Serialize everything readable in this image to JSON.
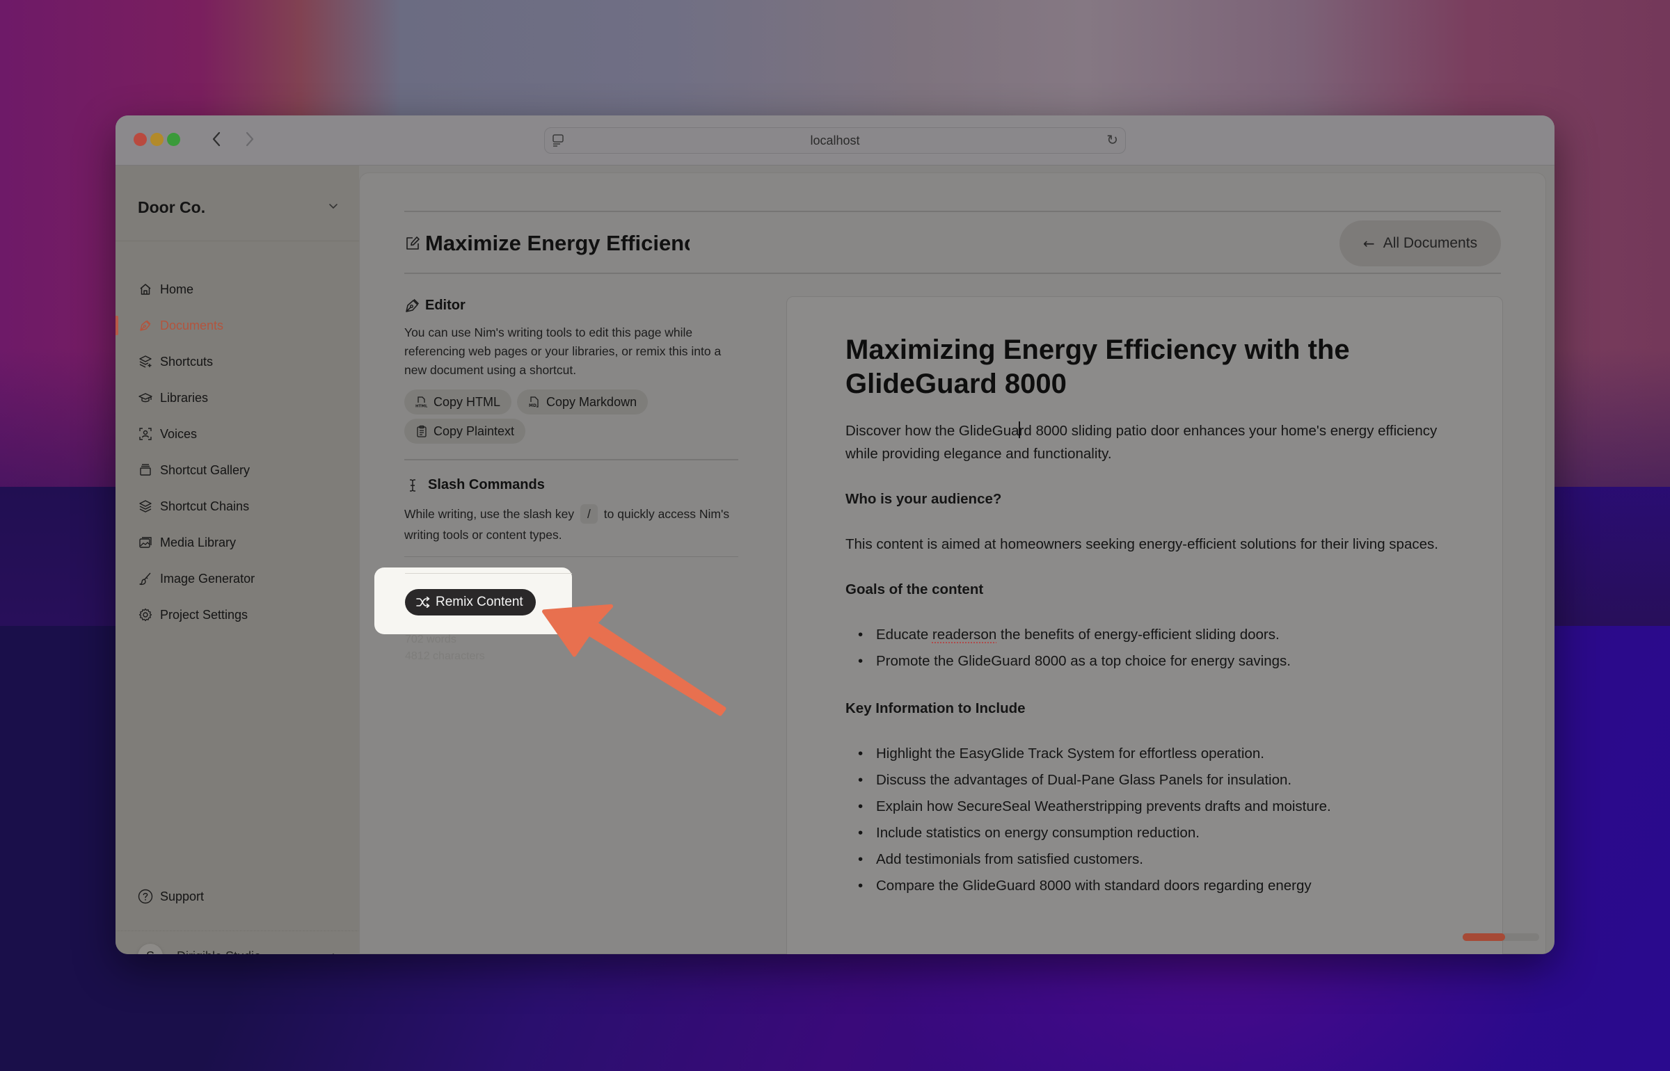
{
  "browser": {
    "url": "localhost",
    "back_label": "‹",
    "forward_label": "›",
    "reload_glyph": "↻"
  },
  "sidebar": {
    "org_name": "Door Co.",
    "items": [
      {
        "label": "Home",
        "icon": "home-icon",
        "active": false
      },
      {
        "label": "Documents",
        "icon": "pen-nib-icon",
        "active": true
      },
      {
        "label": "Shortcuts",
        "icon": "layers-plus-icon",
        "active": false
      },
      {
        "label": "Libraries",
        "icon": "graduation-cap-icon",
        "active": false
      },
      {
        "label": "Voices",
        "icon": "user-scan-icon",
        "active": false
      },
      {
        "label": "Shortcut Gallery",
        "icon": "gallery-icon",
        "active": false
      },
      {
        "label": "Shortcut Chains",
        "icon": "layers-icon",
        "active": false
      },
      {
        "label": "Media Library",
        "icon": "images-icon",
        "active": false
      },
      {
        "label": "Image Generator",
        "icon": "brush-icon",
        "active": false
      },
      {
        "label": "Project Settings",
        "icon": "gear-icon",
        "active": false
      }
    ],
    "support_label": "Support",
    "account": {
      "initial": "S",
      "name": "Dirigible Studio"
    }
  },
  "header": {
    "doc_title": "Maximize Energy Efficienc",
    "all_documents_label": "All Documents",
    "back_arrow": "←"
  },
  "editor_panel": {
    "heading": "Editor",
    "description": "You can use Nim's writing tools to edit this page while referencing web pages or your libraries, or remix this into a new document using a shortcut.",
    "buttons": {
      "copy_html": "Copy HTML",
      "copy_markdown": "Copy Markdown",
      "copy_plaintext": "Copy Plaintext"
    }
  },
  "slash_panel": {
    "heading": "Slash Commands",
    "text_before": "While writing, use the slash key",
    "key": "/",
    "text_after": "to quickly access Nim's writing tools or content types."
  },
  "remix": {
    "label": "Remix Content"
  },
  "stats": {
    "words": "702 words",
    "characters": "4812 characters"
  },
  "document": {
    "title": "Maximizing Energy Efficiency with the GlideGuard 8000",
    "intro_before_cursor": "Discover how the GlideGua",
    "intro_after_cursor": "rd 8000 sliding patio door enhances your home's energy efficiency while providing elegance and functionality.",
    "audience_heading": "Who is your audience?",
    "audience_text": "This content is aimed at homeowners seeking energy-efficient solutions for their living spaces.",
    "goals_heading": "Goals of the content",
    "goals": [
      {
        "before": "Educate ",
        "misspelled": "readerson",
        "after": " the benefits of energy-efficient sliding doors."
      },
      {
        "before": "Promote the GlideGuard 8000 as a top choice for energy savings.",
        "misspelled": "",
        "after": ""
      }
    ],
    "key_info_heading": "Key Information to Include",
    "key_info": [
      "Highlight the EasyGlide Track System for effortless operation.",
      "Discuss the advantages of Dual-Pane Glass Panels for insulation.",
      "Explain how SecureSeal Weatherstripping prevents drafts and moisture.",
      "Include statistics on energy consumption reduction.",
      "Add testimonials from satisfied customers.",
      "Compare the GlideGuard 8000 with standard doors regarding energy"
    ]
  },
  "scroll_progress": 0.55,
  "colors": {
    "accent": "#b3543d",
    "annotation_arrow": "#e8704f",
    "remix_button": "#2a2829"
  }
}
